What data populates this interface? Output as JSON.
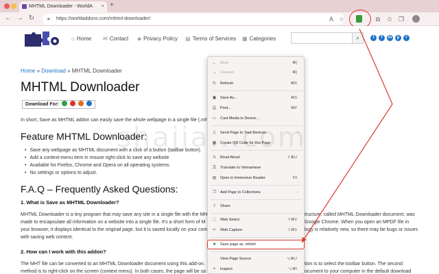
{
  "browser": {
    "tab_title": "MHTML Downloader - WorldA",
    "url": "https://worldaddons.com/mhtml-downloader/",
    "tab_close": "×",
    "new_tab": "+",
    "colors": {
      "accent": "#d93a2b",
      "tabbar": "#e7d1d3"
    }
  },
  "site": {
    "nav": [
      {
        "label": "Home",
        "icon": "home-icon"
      },
      {
        "label": "Contact",
        "icon": "mail-icon"
      },
      {
        "label": "Privacy Policy",
        "icon": "shield-icon"
      },
      {
        "label": "Terms of Services",
        "icon": "document-icon"
      },
      {
        "label": "Categories",
        "icon": "grid-icon"
      }
    ],
    "social": [
      "twitter-icon",
      "facebook-icon",
      "linkedin-icon",
      "pinterest-icon",
      "reddit-icon"
    ]
  },
  "article": {
    "breadcrumb": {
      "home": "Home",
      "download": "Download",
      "current": "MHTML Downloader",
      "sep": "»"
    },
    "title": "MHTML Downloader",
    "download_for": "Download For:",
    "intro": "In short, Save as MHTML addon can easily save the whole webpage in a single file (.mht",
    "feature_heading": "Feature MHTML Downloader:",
    "features": [
      "Save any webpage as MHTML document with a click of a button (toolbar button).",
      "Add a context-menu item in mouse right-click to save any website",
      "Available for Firefox, Chrome and Opera on all operating systems.",
      "No settings or options to adjust."
    ],
    "faq_heading": "F.A.Q – Frequently Asked Questions:",
    "q1": "1. What is Save as MHTML Downloader?",
    "a1_left": [
      "MHTML Downloader is a tiny program that may save any site in a single file with the MH",
      "made to encapsulate all information on a website into a single file. It's a short form of M",
      "your browser, it displays identical to the original page, but it is saved locally on your com",
      "with saving web content."
    ],
    "a1_right": [
      "tructure, called MHTML Downloader document, was",
      "Google Chrome. When you open an MPDF file in",
      "logy is relatively new, so there may be bugs or issues"
    ],
    "q2": "2. How can I work with this addon?",
    "a2_left": [
      "The MHT file can be converted to an MHTML Downloader document using this add-on.",
      "method is to right-click on the screen (context menu). In both cases, the page will be sa"
    ],
    "a2_right": [
      "tion is to select the toolbar button. The second",
      "ocument to your computer in the default download"
    ]
  },
  "context_menu": {
    "items": [
      {
        "label": "Back",
        "shortcut": "⌘[",
        "icon": "back-arrow-icon",
        "disabled": true
      },
      {
        "label": "Forward",
        "shortcut": "⌘]",
        "icon": "forward-arrow-icon",
        "disabled": true
      },
      {
        "label": "Refresh",
        "shortcut": "⌘R",
        "icon": "refresh-icon"
      },
      {
        "label": "Save As...",
        "shortcut": "⌘S",
        "icon": "save-icon"
      },
      {
        "label": "Print...",
        "shortcut": "⌘P",
        "icon": "print-icon"
      },
      {
        "label": "Cast Media to Device...",
        "shortcut": "",
        "icon": "cast-icon"
      },
      {
        "label": "Send Page to Your Devices",
        "shortcut": "",
        "icon": "devices-icon",
        "submenu": true
      },
      {
        "label": "Create QR Code for this Page",
        "shortcut": "",
        "icon": "qr-icon"
      },
      {
        "label": "Read Aloud",
        "shortcut": "⇧⌘U",
        "icon": "speaker-icon"
      },
      {
        "label": "Translate to Vietnamese",
        "shortcut": "",
        "icon": "translate-icon"
      },
      {
        "label": "Open in Immersive Reader",
        "shortcut": "F9",
        "icon": "book-icon"
      },
      {
        "label": "Add Page to Collections",
        "shortcut": "",
        "icon": "collections-icon",
        "submenu": true
      },
      {
        "label": "Share",
        "shortcut": "",
        "icon": "share-icon"
      },
      {
        "label": "Web Select",
        "shortcut": "⇧⌘X",
        "icon": "select-icon"
      },
      {
        "label": "Web Capture",
        "shortcut": "⇧⌘S",
        "icon": "capture-icon"
      },
      {
        "label": "Save page as .mhtml",
        "shortcut": "",
        "icon": "mhtml-icon",
        "highlight": true
      },
      {
        "label": "View Page Source",
        "shortcut": "⌥⌘U",
        "icon": ""
      },
      {
        "label": "Inspect",
        "shortcut": "⌥⌘I",
        "icon": "inspect-icon"
      }
    ],
    "submenu_arrow": "›"
  },
  "watermark": "shajia...com"
}
